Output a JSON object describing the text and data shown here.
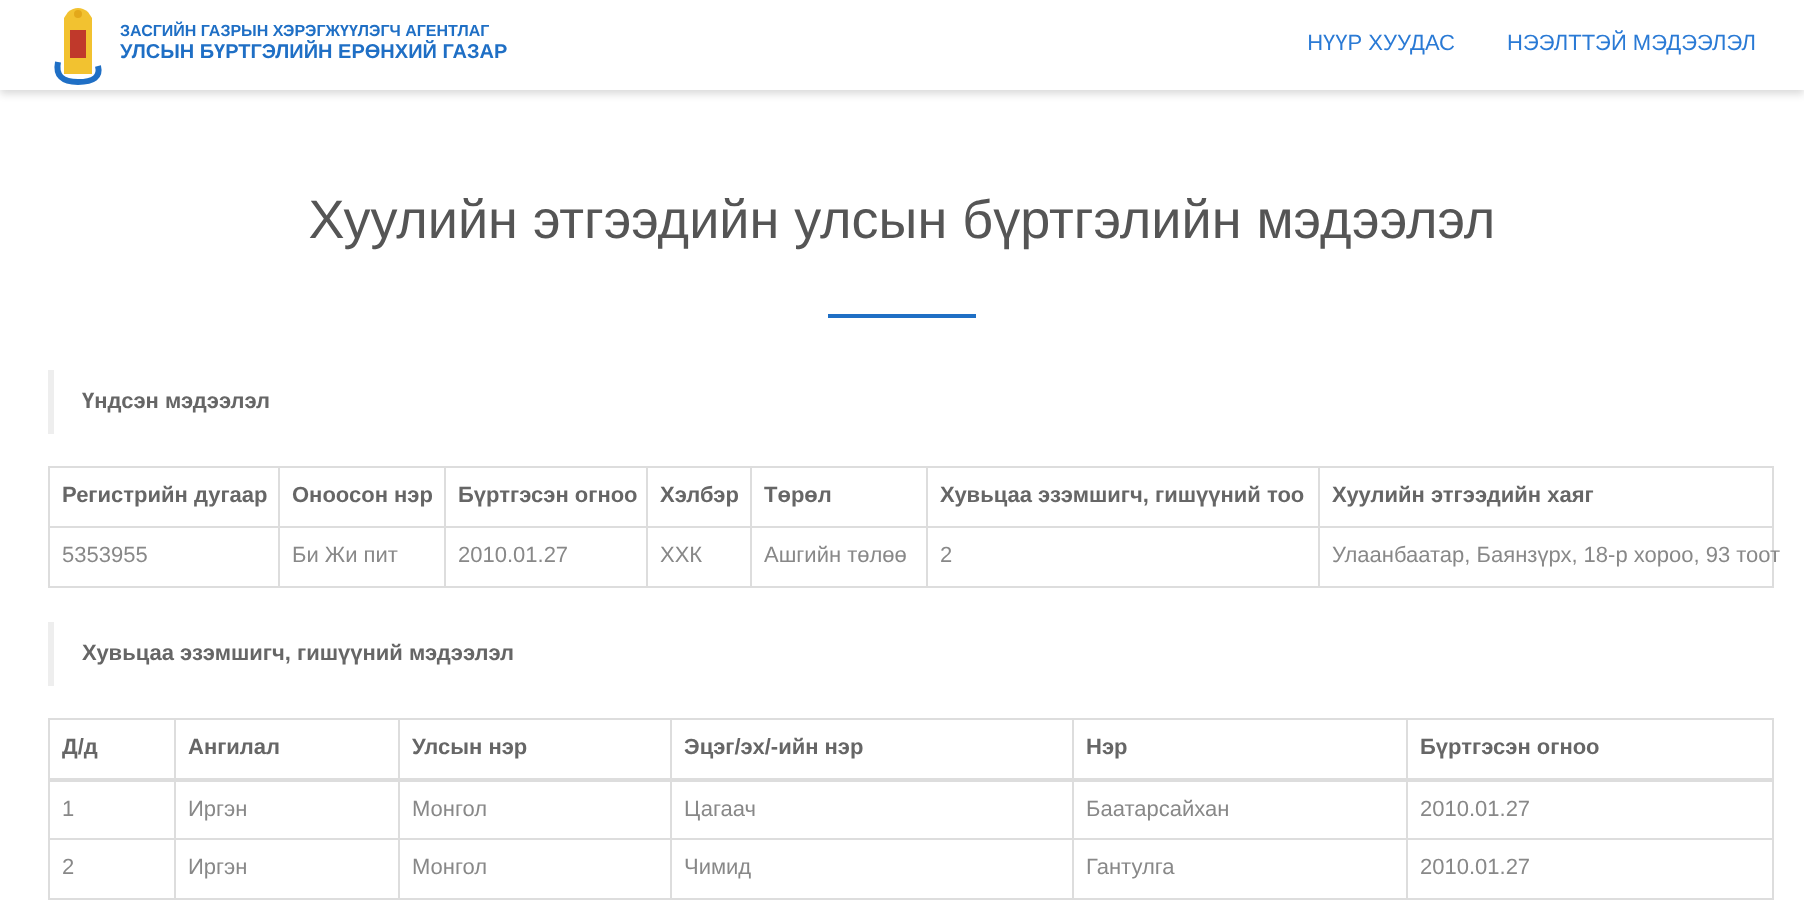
{
  "header": {
    "org_line_1": "ЗАСГИЙН ГАЗРЫН ХЭРЭГЖҮҮЛЭГЧ АГЕНТЛАГ",
    "org_line_2": "УЛСЫН БҮРТГЭЛИЙН ЕРӨНХИЙ ГАЗАР",
    "nav": [
      "НҮҮР ХУУДАС",
      "НЭЭЛТТЭЙ МЭДЭЭЛЭЛ"
    ]
  },
  "title": "Хуулийн этгээдийн улсын бүртгэлийн мэдээлэл",
  "sections": [
    {
      "heading": "Үндсэн мэдээлэл",
      "table": {
        "columns": [
          "Регистрийн дугаар",
          "Оноосон нэр",
          "Бүртгэсэн огноо",
          "Хэлбэр",
          "Төрөл",
          "Хувьцаа эзэмшигч, гишүүний тоо",
          "Хуулийн этгээдийн хаяг"
        ],
        "rows": [
          [
            "5353955",
            "Би Жи пит",
            "2010.01.27",
            "ХХК",
            "Ашгийн төлөө",
            "2",
            "Улаанбаатар, Баянзүрх, 18-р хороо, 93 тоот"
          ]
        ]
      }
    },
    {
      "heading": "Хувьцаа эзэмшигч, гишүүний мэдээлэл",
      "table": {
        "columns": [
          "Д/д",
          "Ангилал",
          "Улсын нэр",
          "Эцэг/эх/-ийн нэр",
          "Нэр",
          "Бүртгэсэн огноо"
        ],
        "rows": [
          [
            "1",
            "Иргэн",
            "Монгол",
            "Цагаач",
            "Баатарсайхан",
            "2010.01.27"
          ],
          [
            "2",
            "Иргэн",
            "Монгол",
            "Чимид",
            "Гантулга",
            "2010.01.27"
          ]
        ]
      }
    }
  ]
}
